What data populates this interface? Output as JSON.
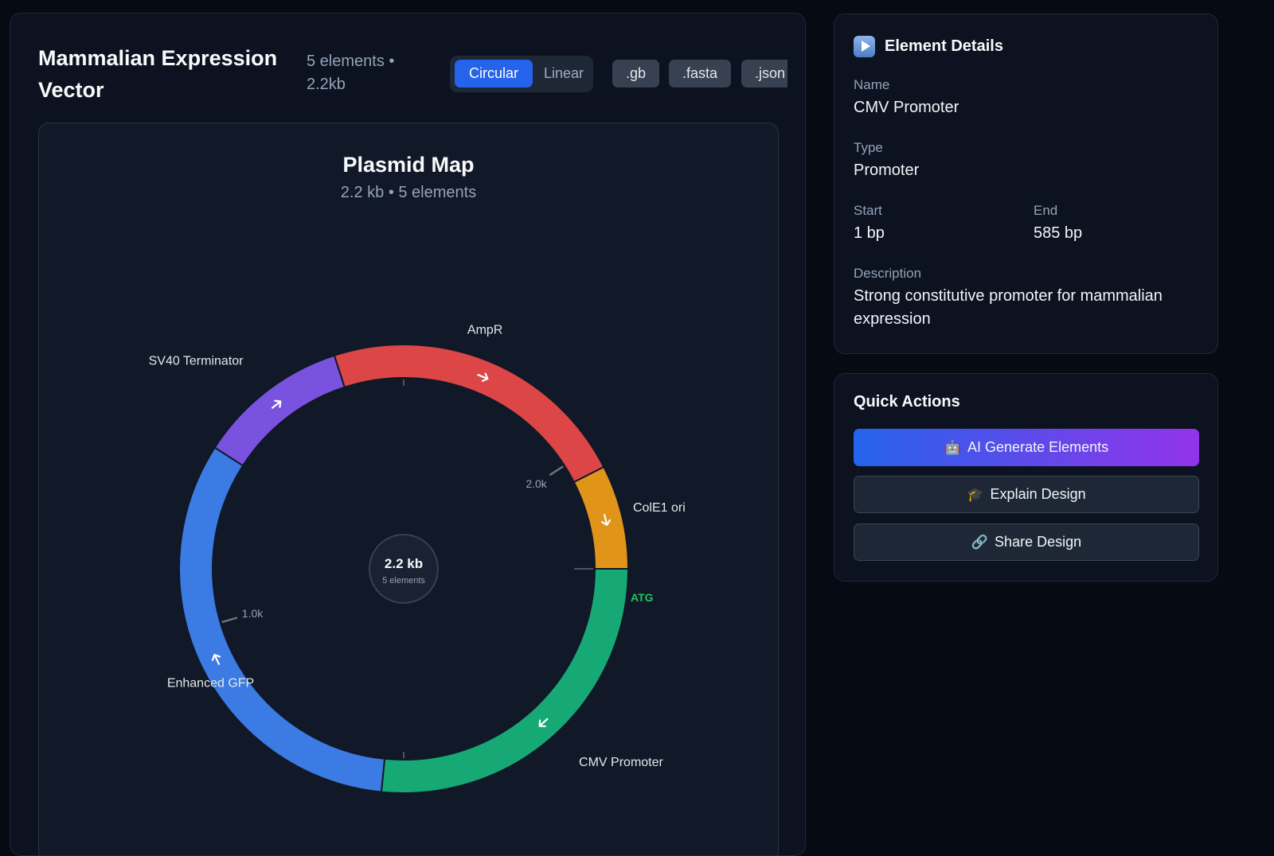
{
  "header": {
    "title": "Mammalian Expression Vector",
    "meta": "5 elements • 2.2kb",
    "view_toggle": {
      "circular": "Circular",
      "linear": "Linear"
    },
    "exports": [
      ".gb",
      ".fasta",
      ".json"
    ]
  },
  "map": {
    "title": "Plasmid Map",
    "subtitle": "2.2 kb • 5 elements",
    "center_size": "2.2 kb",
    "center_count": "5 elements",
    "start_codon": "ATG",
    "ticks": [
      {
        "label": "2.0k"
      },
      {
        "label": "1.0k"
      }
    ]
  },
  "chart_data": {
    "type": "circular-plasmid",
    "total_bp": 2200,
    "segments": [
      {
        "name": "CMV Promoter",
        "start": 1,
        "end": 585,
        "color": "#16a975"
      },
      {
        "name": "Enhanced GFP",
        "start": 586,
        "end": 1300,
        "color": "#3b7be3"
      },
      {
        "name": "SV40 Terminator",
        "start": 1301,
        "end": 1540,
        "color": "#7a52e0"
      },
      {
        "name": "AmpR",
        "start": 1541,
        "end": 2035,
        "color": "#dc4646"
      },
      {
        "name": "ColE1 ori",
        "start": 2036,
        "end": 2200,
        "color": "#e0951a"
      }
    ],
    "tick_positions": [
      2000,
      1000
    ]
  },
  "colors": {
    "accent": "#2563eb",
    "start_codon": "#22c55e"
  },
  "details": {
    "title": "Element Details",
    "icon": "play-icon",
    "name_label": "Name",
    "name": "CMV Promoter",
    "type_label": "Type",
    "type": "Promoter",
    "start_label": "Start",
    "start": "1 bp",
    "end_label": "End",
    "end": "585 bp",
    "description_label": "Description",
    "description": "Strong constitutive promoter for mammalian expression"
  },
  "actions": {
    "title": "Quick Actions",
    "ai_generate": {
      "icon": "🤖",
      "label": "AI Generate Elements"
    },
    "explain": {
      "icon": "🎓",
      "label": "Explain Design"
    },
    "share": {
      "icon": "🔗",
      "label": "Share Design"
    }
  }
}
